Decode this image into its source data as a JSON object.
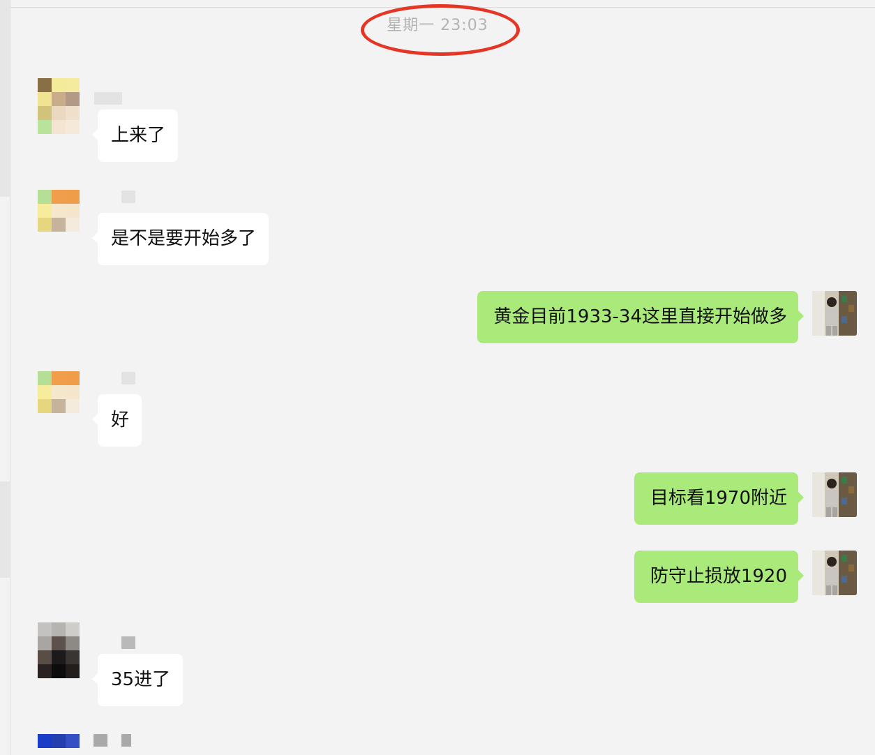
{
  "timestamp": "星期一 23:03",
  "messages": [
    {
      "side": "in",
      "text": "上来了"
    },
    {
      "side": "in",
      "text": "是不是要开始多了"
    },
    {
      "side": "out",
      "text": "黄金目前1933-34这里直接开始做多"
    },
    {
      "side": "in",
      "text": "好"
    },
    {
      "side": "out",
      "text": "目标看1970附近"
    },
    {
      "side": "out",
      "text": "防守止损放1920"
    },
    {
      "side": "in",
      "text": "35进了"
    }
  ]
}
